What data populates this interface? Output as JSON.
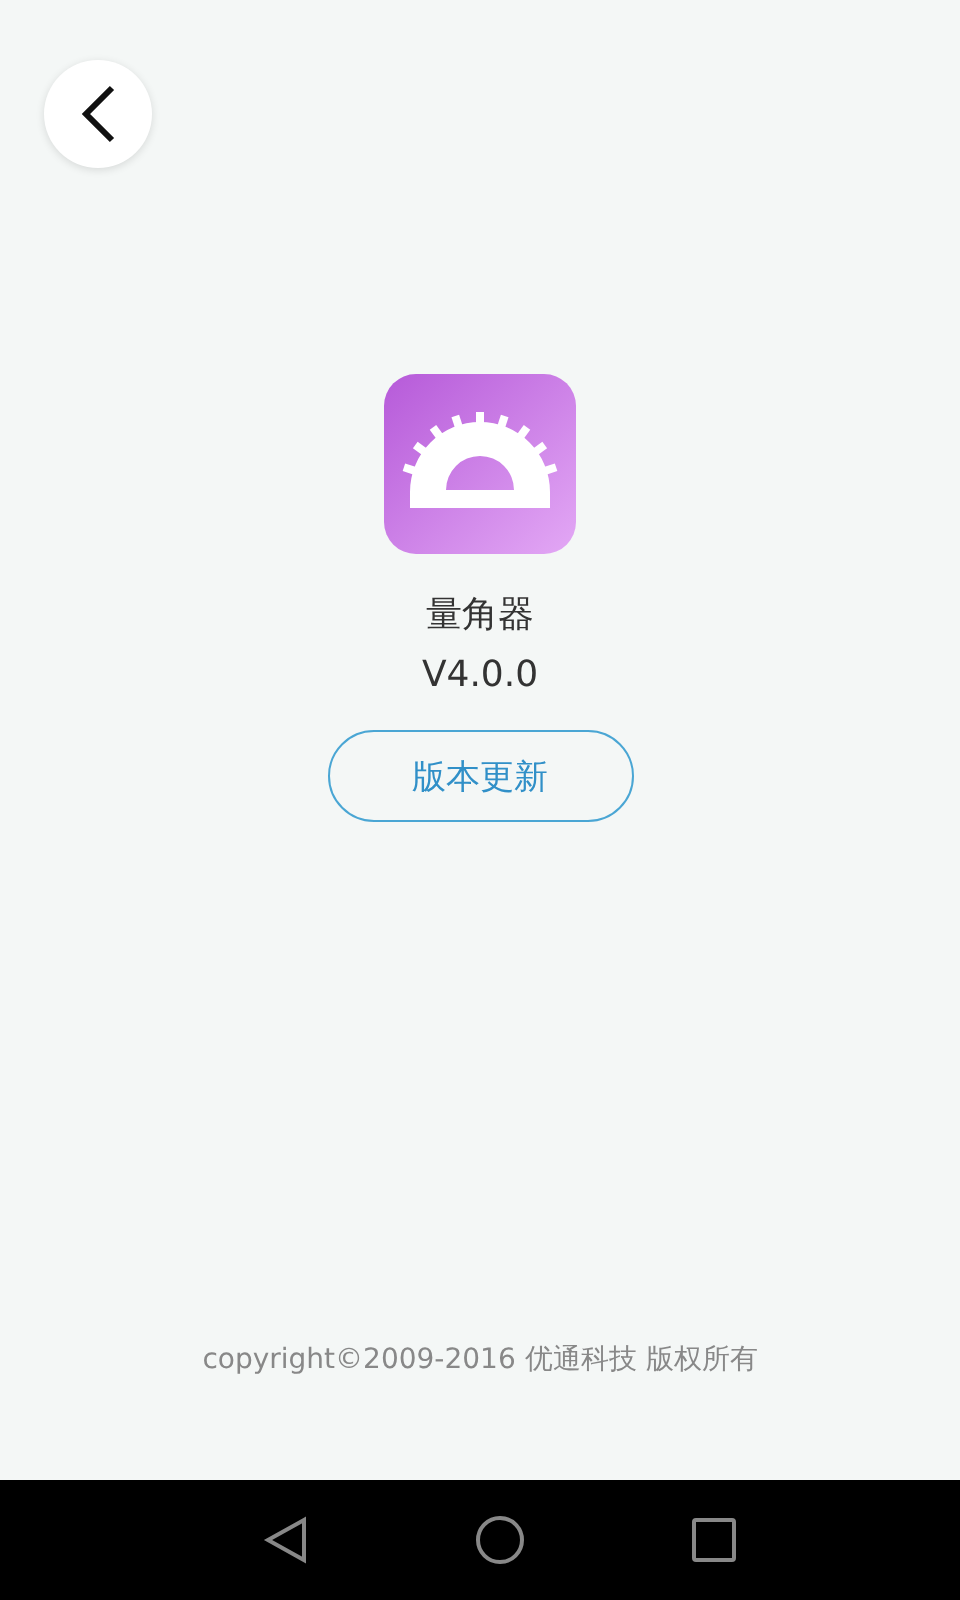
{
  "app": {
    "name": "量角器",
    "version": "V4.0.0"
  },
  "update_button": {
    "label": "版本更新"
  },
  "copyright": "copyright©2009-2016 优通科技 版权所有"
}
